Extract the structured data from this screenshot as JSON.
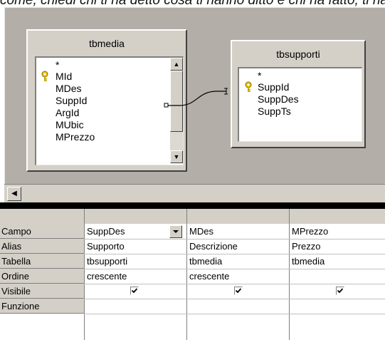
{
  "top_strip_text": "come, chiedi chi ti ha detto cosa ti hanno ditto e chi ha fatto, ti ha tolto",
  "tables": [
    {
      "title": "tbmedia",
      "fields": [
        "*",
        "MId",
        "MDes",
        "SuppId",
        "ArgId",
        "MUbic",
        "MPrezzo"
      ],
      "key_field": "MId"
    },
    {
      "title": "tbsupporti",
      "fields": [
        "*",
        "SuppId",
        "SuppDes",
        "SuppTs"
      ],
      "key_field": "SuppId"
    }
  ],
  "grid": {
    "row_labels": [
      "Campo",
      "Alias",
      "Tabella",
      "Ordine",
      "Visibile",
      "Funzione"
    ],
    "columns": [
      {
        "campo": "SuppDes",
        "alias": "Supporto",
        "tabella": "tbsupporti",
        "ordine": "crescente",
        "visibile": true,
        "funzione": ""
      },
      {
        "campo": "MDes",
        "alias": "Descrizione",
        "tabella": "tbmedia",
        "ordine": "crescente",
        "visibile": true,
        "funzione": ""
      },
      {
        "campo": "MPrezzo",
        "alias": "Prezzo",
        "tabella": "tbmedia",
        "ordine": "",
        "visibile": true,
        "funzione": ""
      }
    ]
  }
}
